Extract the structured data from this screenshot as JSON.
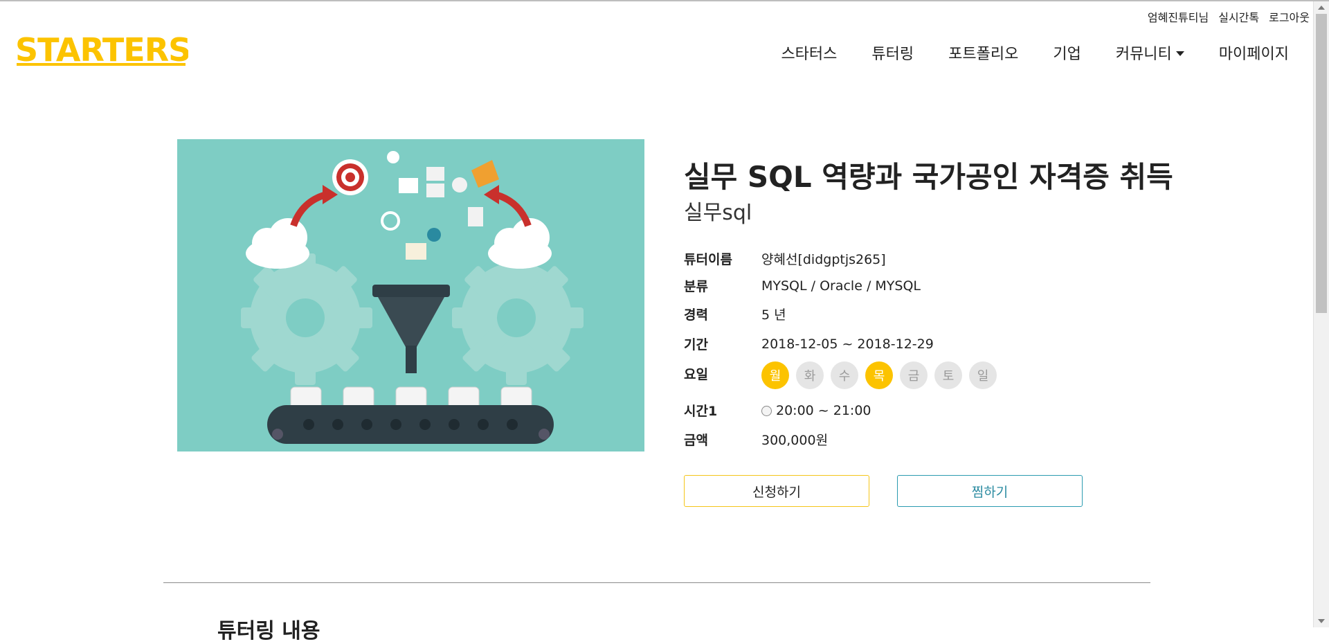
{
  "header": {
    "logo_text": "STARTERS",
    "user_greeting": "엄혜진튜티님",
    "chat_link": "실시간톡",
    "logout_link": "로그아웃",
    "nav": [
      {
        "label": "스타터스"
      },
      {
        "label": "튜터링"
      },
      {
        "label": "포트폴리오"
      },
      {
        "label": "기업"
      },
      {
        "label": "커뮤니티"
      },
      {
        "label": "마이페이지"
      }
    ]
  },
  "course": {
    "title": "실무 SQL 역량과 국가공인 자격증 취득",
    "subtitle": "실무sql",
    "tutor_name_label": "튜터이름",
    "tutor_name": "양혜선[didgptjs265]",
    "category_label": "분류",
    "category": "MYSQL / Oracle / MYSQL",
    "career_label": "경력",
    "career": "5 년",
    "period_label": "기간",
    "period": "2018-12-05 ~ 2018-12-29",
    "days_label": "요일",
    "days": [
      {
        "label": "월",
        "active": true
      },
      {
        "label": "화",
        "active": false
      },
      {
        "label": "수",
        "active": false
      },
      {
        "label": "목",
        "active": true
      },
      {
        "label": "금",
        "active": false
      },
      {
        "label": "토",
        "active": false
      },
      {
        "label": "일",
        "active": false
      }
    ],
    "time_label": "시간1",
    "time": "20:00 ~ 21:00",
    "price_label": "금액",
    "price": "300,000원",
    "apply_button": "신청하기",
    "wish_button": "찜하기"
  },
  "section": {
    "title": "튜터링 내용"
  },
  "colors": {
    "brand": "#fcc300",
    "hero_bg": "#7ecdc4",
    "wish_border": "#2a9bb0"
  }
}
